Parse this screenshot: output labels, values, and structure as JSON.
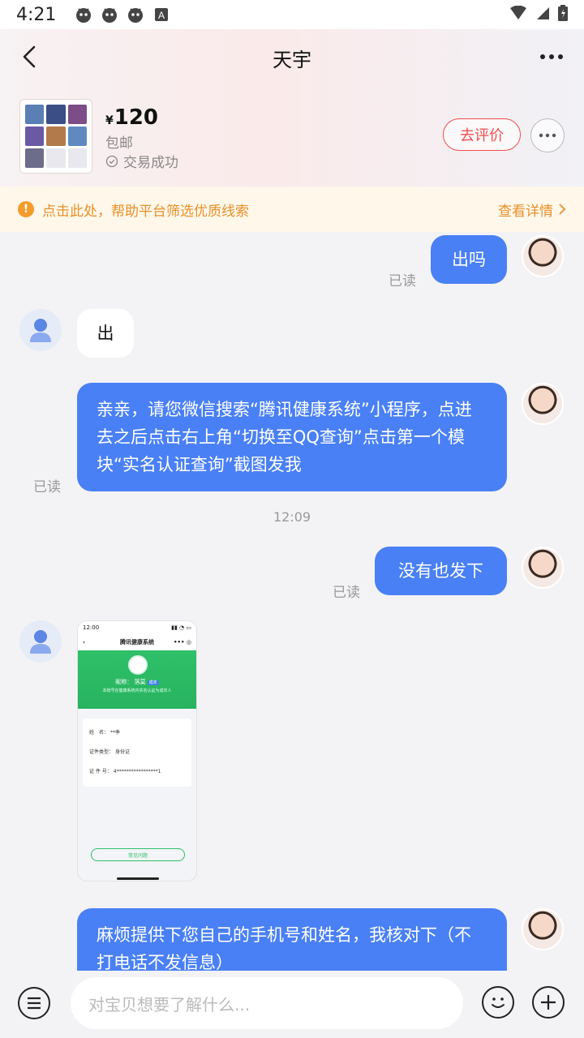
{
  "status_bar": {
    "time": "4:21"
  },
  "nav": {
    "title": "天宇"
  },
  "product": {
    "currency": "¥",
    "price": "120",
    "shipping": "包邮",
    "status": "交易成功",
    "review_label": "去评价"
  },
  "notice": {
    "text": "点击此处，帮助平台筛选优质线索",
    "link_label": "查看详情"
  },
  "messages": [
    {
      "from": "me",
      "text": "出吗",
      "read": "已读"
    },
    {
      "from": "them",
      "text": "出"
    },
    {
      "from": "me",
      "text": "亲亲，请您微信搜索“腾讯健康系统”小程序，点进去之后点击右上角“切换至QQ查询”点击第一个模块“实名认证查询”截图发我",
      "read": "已读"
    },
    {
      "from": "me",
      "text": "没有也发下",
      "read": "已读"
    },
    {
      "from": "them",
      "type": "image"
    },
    {
      "from": "me",
      "text": "麻烦提供下您自己的手机号和姓名，我核对下（不打电话不发信息）"
    }
  ],
  "timestamp": "12:09",
  "screenshot": {
    "time": "12:00",
    "title": "腾讯健康系统",
    "nickname": "昵称：",
    "nickname_value": "落莫",
    "tag": "成年",
    "subtitle": "本账号在健康系统内实名认证为成年人",
    "rows": [
      {
        "label": "姓　名：",
        "value": "**季"
      },
      {
        "label": "证件类型：",
        "value": "身份证"
      },
      {
        "label": "证 件 号：",
        "value": "4*****************1"
      }
    ],
    "button": "常见问题"
  },
  "input": {
    "placeholder": "对宝贝想要了解什么..."
  }
}
